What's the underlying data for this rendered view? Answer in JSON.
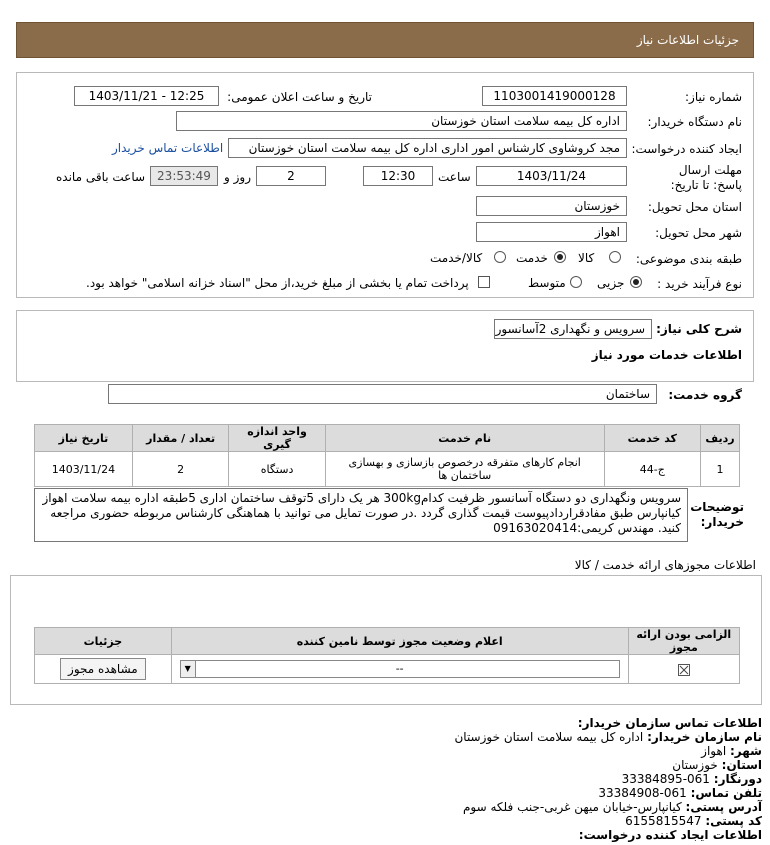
{
  "header": {
    "title": "جزئیات اطلاعات نیاز"
  },
  "need": {
    "need_number_label": "شماره نیاز:",
    "need_number": "1103001419000128",
    "announce_label": "تاریخ و ساعت اعلان عمومی:",
    "announce_value": "1403/11/21 - 12:25",
    "buyer_org_label": "نام دستگاه خریدار:",
    "buyer_org": "اداره کل بیمه سلامت استان خوزستان",
    "creator_label": "ایجاد کننده درخواست:",
    "creator": "مجد کروشاوی کارشناس امور اداری اداره کل بیمه سلامت استان خوزستان",
    "contact_link": "اطلاعات تماس خریدار",
    "deadline_label": "مهلت ارسال پاسخ: تا تاریخ:",
    "deadline_date": "1403/11/24",
    "time_label": "ساعت",
    "deadline_time": "12:30",
    "days_value": "2",
    "days_label": "روز و",
    "remaining_time": "23:53:49",
    "remaining_label": "ساعت باقی مانده",
    "province_label": "استان محل تحویل:",
    "province": "خوزستان",
    "city_label": "شهر محل تحویل:",
    "city": "اهواز",
    "category_label": "طبقه بندی موضوعی:",
    "category_options": [
      "کالا",
      "خدمت",
      "کالا/خدمت"
    ],
    "category_selected": "خدمت",
    "process_label": "نوع فرآیند خرید :",
    "process_options": [
      "جزیی",
      "متوسط"
    ],
    "process_selected": "جزیی",
    "payment_note": "پرداخت تمام یا بخشی از مبلغ خرید،از محل \"اسناد خزانه اسلامی\" خواهد بود."
  },
  "summary": {
    "label": "شرح کلی نیاز:",
    "value": "سرویس و نگهداری 2آسانسور",
    "services_title": "اطلاعات خدمات مورد نیاز",
    "group_label": "گروه خدمت:",
    "group_value": "ساختمان"
  },
  "services_table": {
    "headers": [
      "ردیف",
      "کد خدمت",
      "نام خدمت",
      "واحد اندازه گیری",
      "تعداد / مقدار",
      "تاریخ نیاز"
    ],
    "rows": [
      {
        "row": "1",
        "code": "ج-44",
        "name": "انجام کارهای متفرقه درخصوص بازسازی و بهسازی ساختمان ها",
        "unit": "دستگاه",
        "qty": "2",
        "date": "1403/11/24"
      }
    ]
  },
  "buyer_desc": {
    "label": "توضیحات خریدار:",
    "text": "سرویس ونگهداری دو دستگاه آسانسور ظرفیت کدام300kg هر یک دارای 5توقف ساختمان اداری 5طبقه اداره بیمه سلامت اهواز کیانپارس طبق مفادقراردادپیوست قیمت گذاری گردد .در صورت تمایل می توانید با هماهنگی کارشناس مربوطه حضوری مراجعه کنید. مهندس کریمی:09163020414"
  },
  "permits": {
    "title": "اطلاعات مجوزهای ارائه خدمت / کالا",
    "headers": [
      "الزامی بودن ارائه مجوز",
      "اعلام وضعیت مجوز توسط نامین کننده",
      "جزئیات"
    ],
    "select_value": "--",
    "view_button": "مشاهده مجوز"
  },
  "contact": {
    "title": "اطلاعات تماس سازمان خریدار:",
    "org_label": "نام سازمان خریدار:",
    "org": "اداره کل بیمه سلامت استان خوزستان",
    "city_label": "شهر:",
    "city": "اهواز",
    "province_label": "استان:",
    "province": "خوزستان",
    "fax_label": "دورنگار:",
    "fax": "061-33384895",
    "phone_label": "تلفن تماس:",
    "phone": "061-33384908",
    "address_label": "آدرس پستی:",
    "address": "کیانپارس-خیابان میهن غربی-جنب فلکه سوم",
    "postal_label": "کد پستی:",
    "postal": "6155815547",
    "creator_title": "اطلاعات ایجاد کننده درخواست:"
  },
  "colors": {
    "header_bg": "#8b6c4a",
    "link": "#1a4fa0",
    "table_header_bg": "#dcdcdc"
  }
}
